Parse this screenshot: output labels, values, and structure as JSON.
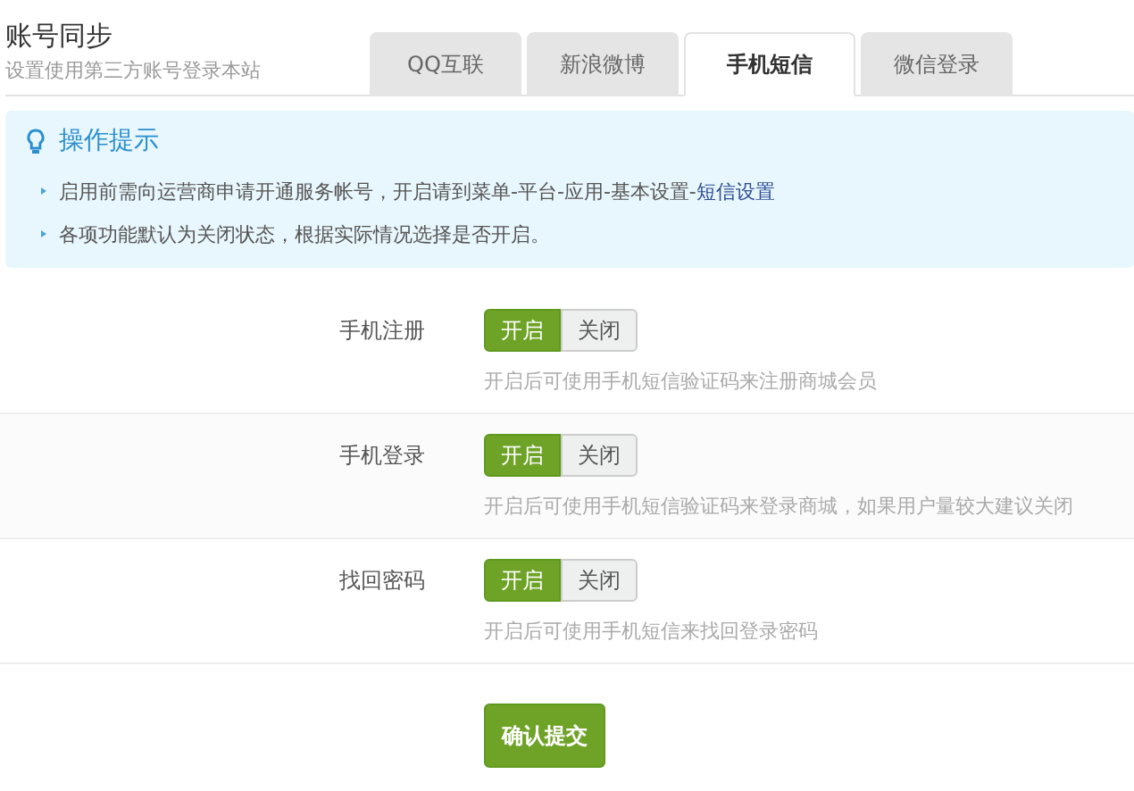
{
  "header": {
    "title": "账号同步",
    "subtitle": "设置使用第三方账号登录本站"
  },
  "tabs": [
    {
      "label": "QQ互联",
      "selected": false
    },
    {
      "label": "新浪微博",
      "selected": false
    },
    {
      "label": "手机短信",
      "selected": true
    },
    {
      "label": "微信登录",
      "selected": false
    }
  ],
  "tips": {
    "title": "操作提示",
    "items": [
      {
        "text": "启用前需向运营商申请开通服务帐号，开启请到菜单-平台-应用-基本设置-",
        "link": "短信设置"
      },
      {
        "text": "各项功能默认为关闭状态，根据实际情况选择是否开启。"
      }
    ]
  },
  "settings": [
    {
      "label": "手机注册",
      "options": [
        {
          "label": "开启",
          "selected": true
        },
        {
          "label": "关闭",
          "selected": false
        }
      ],
      "hint": "开启后可使用手机短信验证码来注册商城会员"
    },
    {
      "label": "手机登录",
      "options": [
        {
          "label": "开启",
          "selected": true
        },
        {
          "label": "关闭",
          "selected": false
        }
      ],
      "hint": "开启后可使用手机短信验证码来登录商城，如果用户量较大建议关闭"
    },
    {
      "label": "找回密码",
      "options": [
        {
          "label": "开启",
          "selected": true
        },
        {
          "label": "关闭",
          "selected": false
        }
      ],
      "hint": "开启后可使用手机短信来找回登录密码"
    }
  ],
  "submit": "确认提交"
}
